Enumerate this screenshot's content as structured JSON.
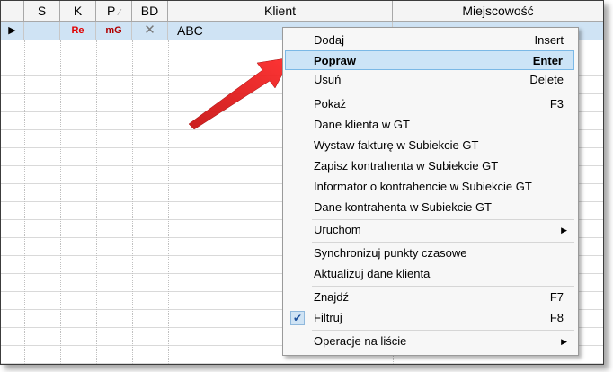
{
  "columns": {
    "s": "S",
    "k": "K",
    "p": "P",
    "p_sort": "⁄",
    "bd": "BD",
    "klient": "Klient",
    "miejscowosc": "Miejscowość"
  },
  "row": {
    "indicator": "▶",
    "k": "Re",
    "p": "mG",
    "bd": "✕",
    "klient": "ABC"
  },
  "menu": {
    "dodaj": "Dodaj",
    "dodaj_sc": "Insert",
    "popraw": "Popraw",
    "popraw_sc": "Enter",
    "usun": "Usuń",
    "usun_sc": "Delete",
    "pokaz": "Pokaż",
    "pokaz_sc": "F3",
    "dane_klienta_gt": "Dane klienta w GT",
    "wystaw_fakture": "Wystaw fakturę w Subiekcie GT",
    "zapisz_kontrahenta": "Zapisz kontrahenta w Subiekcie GT",
    "informator": "Informator o kontrahencie w Subiekcie GT",
    "dane_kontrahenta": "Dane kontrahenta w Subiekcie GT",
    "uruchom": "Uruchom",
    "synchronizuj": "Synchronizuj punkty czasowe",
    "aktualizuj": "Aktualizuj dane klienta",
    "znajdz": "Znajdź",
    "znajdz_sc": "F7",
    "filtruj": "Filtruj",
    "filtruj_sc": "F8",
    "operacje": "Operacje na liście",
    "submenu_arrow": "▶",
    "check_mark": "✔"
  },
  "colors": {
    "selected_row": "#cfe3f4",
    "highlight": "#cce4f7",
    "arrow": "#e82020"
  }
}
